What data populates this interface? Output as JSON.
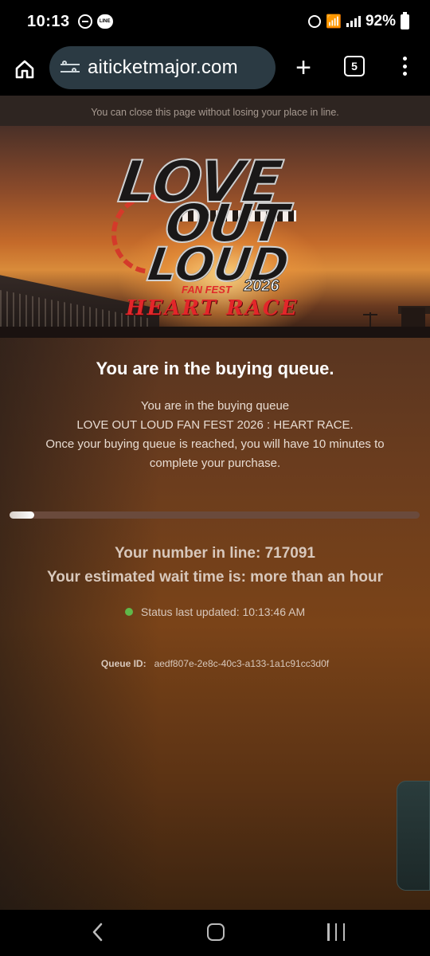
{
  "status_bar": {
    "time": "10:13",
    "battery": "92%"
  },
  "browser": {
    "url": "aiticketmajor.com",
    "tab_count": "5",
    "new_tab_label": "+"
  },
  "page": {
    "close_note": "You can close this page without losing your place in line.",
    "banner": {
      "line1": "LOVE",
      "line2": "OUT",
      "line3": "LOUD",
      "fan_fest": "FAN FEST",
      "year": "2026",
      "subtitle": "HEART RACE"
    },
    "title": "You are in the buying queue.",
    "description_lines": [
      "You are in the buying queue",
      "LOVE OUT LOUD FAN FEST 2026 : HEART RACE.",
      "Once your buying queue is reached, you will have 10 minutes to complete your purchase."
    ],
    "progress": 0.06,
    "line_number": "Your number in line: 717091",
    "wait_time": "Your estimated wait time is: more than an hour",
    "status_updated": "Status last updated: 10:13:46 AM",
    "status_color": "#5fb84a",
    "queue_id_label": "Queue ID:",
    "queue_id": "aedf807e-2e8c-40c3-a133-1a1c91cc3d0f"
  },
  "icons": {
    "home": "home-icon",
    "site_settings": "tune-icon",
    "menu": "more-vert-icon",
    "back": "back-icon",
    "nav_home": "home-square-icon",
    "recents": "recents-icon"
  }
}
